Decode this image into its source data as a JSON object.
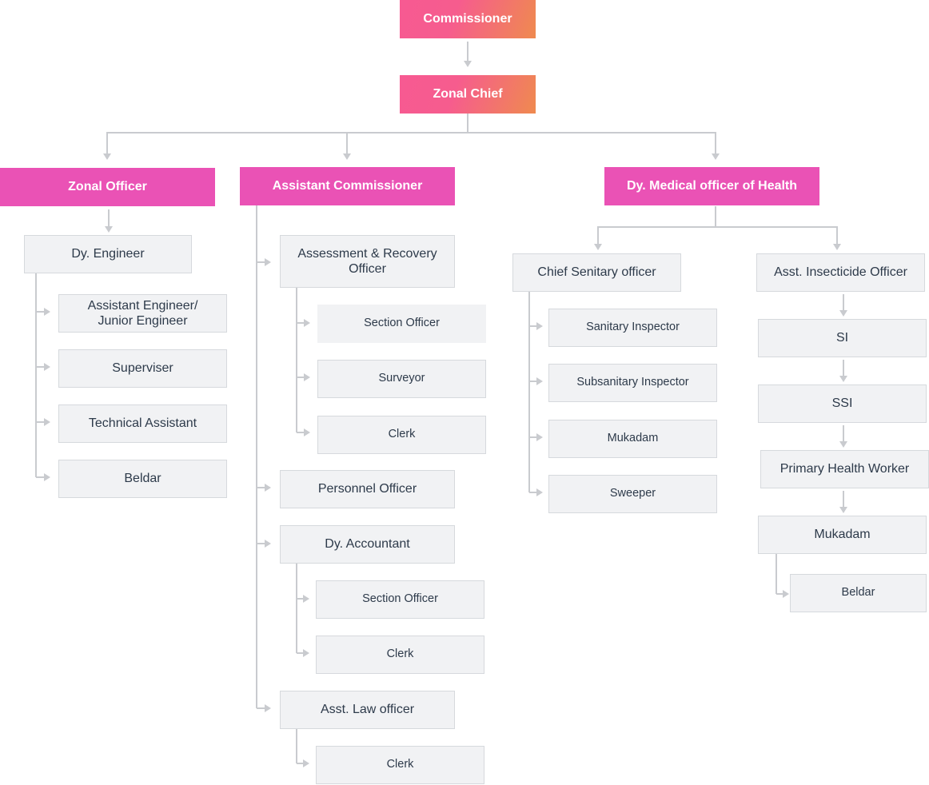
{
  "colors": {
    "gradient_start": "#f75a92",
    "gradient_end": "#ef8a4f",
    "header": "#ea52b5",
    "box": "#f1f2f4",
    "border": "#d6d9dd",
    "line": "#c9cbcf",
    "text": "#2d3a4a"
  },
  "nodes": [
    {
      "id": "commissioner",
      "label": "Commissioner",
      "style": "grad"
    },
    {
      "id": "zonal_chief",
      "label": "Zonal Chief",
      "style": "grad"
    },
    {
      "id": "zonal_officer",
      "label": "Zonal Officer",
      "style": "mag"
    },
    {
      "id": "asst_commissioner",
      "label": "Assistant Commissioner",
      "style": "mag"
    },
    {
      "id": "dy_mo",
      "label": "Dy. Medical officer of Health",
      "style": "mag"
    },
    {
      "id": "dy_engineer",
      "label": "Dy. Engineer",
      "style": "gray"
    },
    {
      "id": "ae",
      "label": "Assistant Engineer/\nJunior Engineer",
      "style": "gray"
    },
    {
      "id": "superviser",
      "label": "Superviser",
      "style": "gray"
    },
    {
      "id": "tech",
      "label": "Technical Assistant",
      "style": "gray"
    },
    {
      "id": "beldar",
      "label": "Beldar",
      "style": "gray"
    },
    {
      "id": "arro",
      "label": "Assessment & Recovery\nOfficer",
      "style": "gray"
    },
    {
      "id": "so1",
      "label": "Section Officer",
      "style": "gray sm nb"
    },
    {
      "id": "surveyor",
      "label": "Surveyor",
      "style": "gray sm"
    },
    {
      "id": "clerk1",
      "label": "Clerk",
      "style": "gray sm"
    },
    {
      "id": "personnel",
      "label": "Personnel Officer",
      "style": "gray"
    },
    {
      "id": "dy_acc",
      "label": "Dy. Accountant",
      "style": "gray"
    },
    {
      "id": "so2",
      "label": "Section Officer",
      "style": "gray sm"
    },
    {
      "id": "clerk2",
      "label": "Clerk",
      "style": "gray sm"
    },
    {
      "id": "law",
      "label": "Asst. Law officer",
      "style": "gray"
    },
    {
      "id": "clerk3",
      "label": "Clerk",
      "style": "gray sm"
    },
    {
      "id": "cso",
      "label": "Chief Senitary officer",
      "style": "gray"
    },
    {
      "id": "sanitary",
      "label": "Sanitary Inspector",
      "style": "gray sm"
    },
    {
      "id": "subsan",
      "label": "Subsanitary Inspector",
      "style": "gray sm"
    },
    {
      "id": "mukadam1",
      "label": "Mukadam",
      "style": "gray sm"
    },
    {
      "id": "sweeper",
      "label": "Sweeper",
      "style": "gray sm"
    },
    {
      "id": "aio",
      "label": "Asst. Insecticide Officer",
      "style": "gray"
    },
    {
      "id": "si",
      "label": "SI",
      "style": "gray"
    },
    {
      "id": "ssi",
      "label": "SSI",
      "style": "gray"
    },
    {
      "id": "phw",
      "label": "Primary Health Worker",
      "style": "gray"
    },
    {
      "id": "mukadam2",
      "label": "Mukadam",
      "style": "gray"
    },
    {
      "id": "beldar2",
      "label": "Beldar",
      "style": "gray sm"
    }
  ]
}
